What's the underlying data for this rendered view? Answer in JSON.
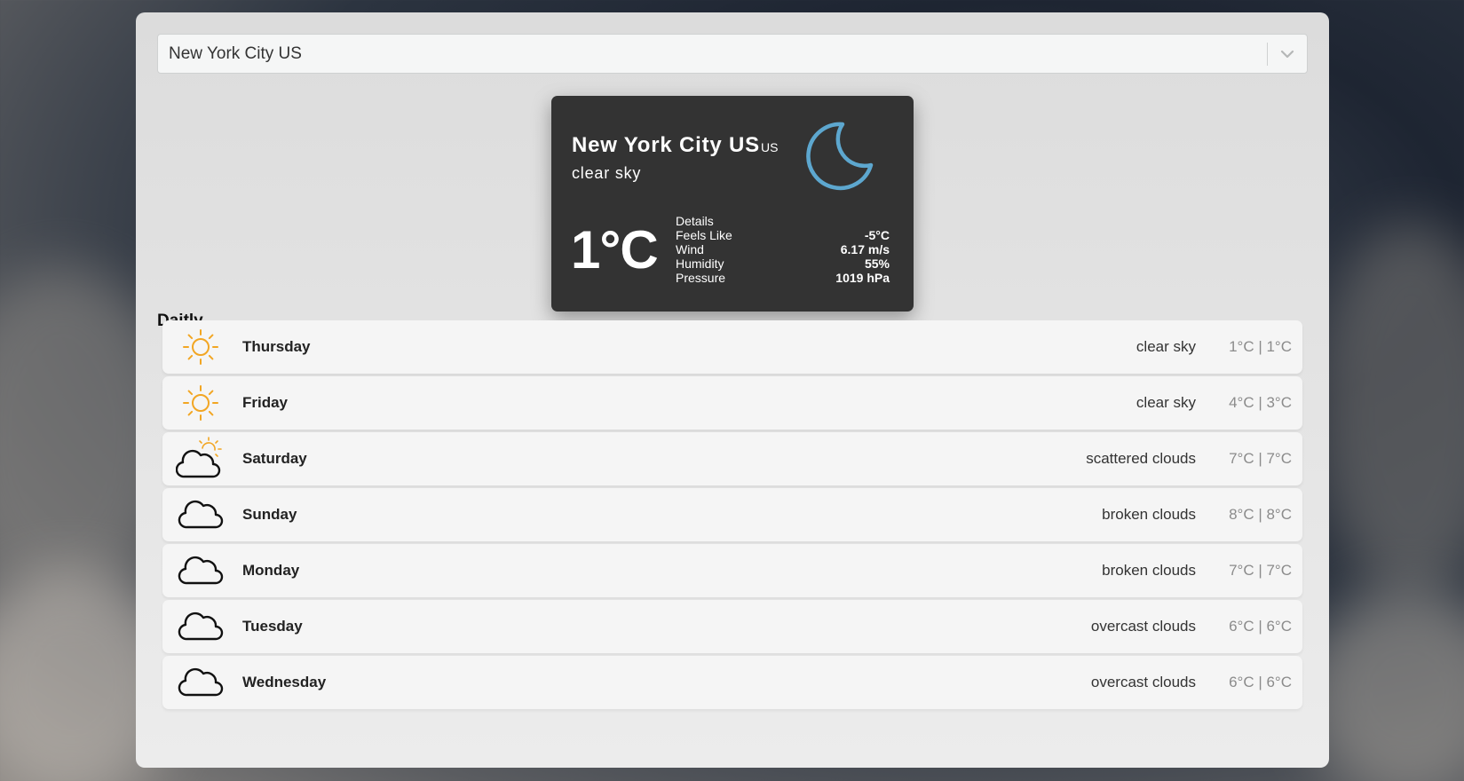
{
  "location_select": {
    "value": "New York City US",
    "arrow_icon": "chevron-down-icon"
  },
  "current": {
    "city": "New York City US",
    "country": "US",
    "description": "clear sky",
    "icon": "moon-icon",
    "icon_color": "#5da7cf",
    "temperature": "1°C",
    "details_title": "Details",
    "details": [
      {
        "label": "Feels Like",
        "value": "-5°C"
      },
      {
        "label": "Wind",
        "value": "6.17 m/s"
      },
      {
        "label": "Humidity",
        "value": "55%"
      },
      {
        "label": "Pressure",
        "value": "1019 hPa"
      }
    ]
  },
  "daily": {
    "title": "Daitly",
    "days": [
      {
        "name": "Thursday",
        "description": "clear sky",
        "temps": "1°C | 1°C",
        "icon": "sun-icon"
      },
      {
        "name": "Friday",
        "description": "clear sky",
        "temps": "4°C | 3°C",
        "icon": "sun-icon"
      },
      {
        "name": "Saturday",
        "description": "scattered clouds",
        "temps": "7°C | 7°C",
        "icon": "cloud-sun-icon"
      },
      {
        "name": "Sunday",
        "description": "broken clouds",
        "temps": "8°C | 8°C",
        "icon": "cloud-icon"
      },
      {
        "name": "Monday",
        "description": "broken clouds",
        "temps": "7°C | 7°C",
        "icon": "cloud-icon"
      },
      {
        "name": "Tuesday",
        "description": "overcast clouds",
        "temps": "6°C | 6°C",
        "icon": "cloud-icon"
      },
      {
        "name": "Wednesday",
        "description": "overcast clouds",
        "temps": "6°C | 6°C",
        "icon": "cloud-icon"
      }
    ]
  },
  "colors": {
    "sun": "#f2a623",
    "card_background": "#333333"
  }
}
